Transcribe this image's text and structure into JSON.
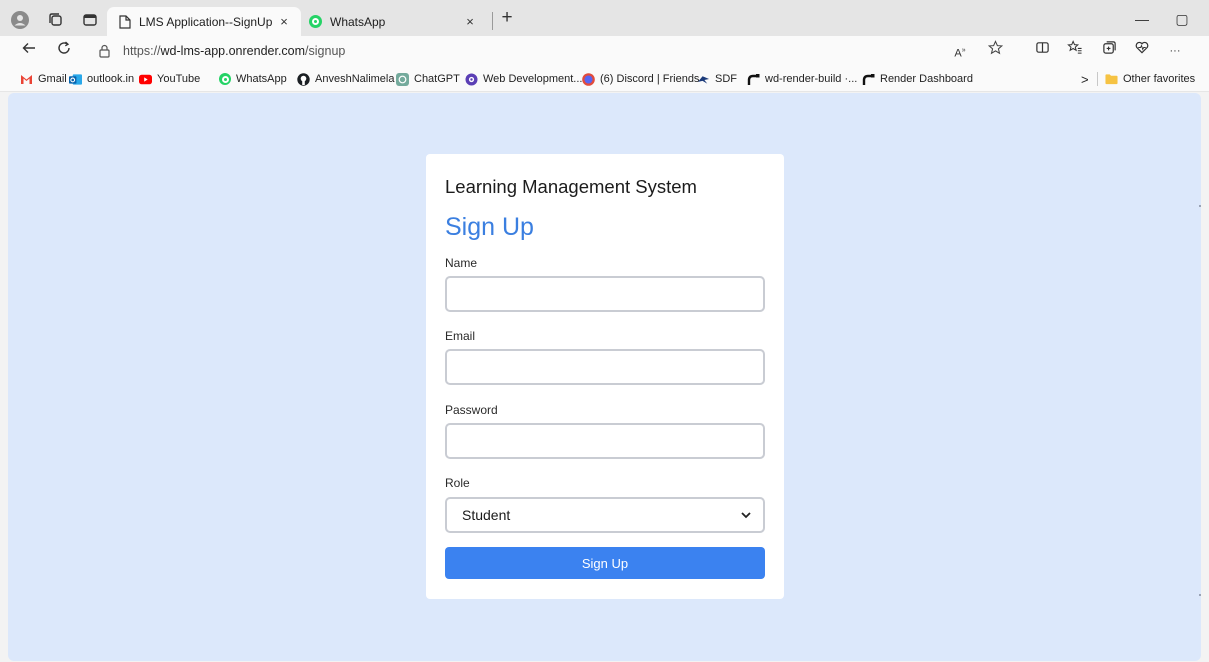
{
  "browser": {
    "tabs": [
      {
        "title": "LMS Application--SignUp Page",
        "close": "×",
        "active": true
      },
      {
        "title": "WhatsApp",
        "close": "×",
        "active": false
      }
    ],
    "new_tab": "+",
    "window_controls": {
      "minimize": "—",
      "restore": "▢"
    },
    "address_bar": {
      "scheme": "https://",
      "host": "wd-lms-app.onrender.com",
      "path": "/signup"
    },
    "toolbar_icons": [
      "read-aloud-icon",
      "favorite-star-icon",
      "split-screen-icon",
      "favorites-icon",
      "collections-icon",
      "health-icon",
      "more-icon"
    ],
    "more_label": "···",
    "favorites": [
      {
        "label": "Gmail",
        "icon": "gmail-icon"
      },
      {
        "label": "outlook.in",
        "icon": "outlook-icon"
      },
      {
        "label": "YouTube",
        "icon": "youtube-icon"
      },
      {
        "label": "WhatsApp",
        "icon": "whatsapp-icon"
      },
      {
        "label": "AnveshNalimela",
        "icon": "github-icon"
      },
      {
        "label": "ChatGPT",
        "icon": "chatgpt-icon"
      },
      {
        "label": "Web Development...",
        "icon": "web-dev-icon"
      },
      {
        "label": "(6) Discord | Friends",
        "icon": "discord-icon"
      },
      {
        "label": "SDF",
        "icon": "sdf-icon"
      },
      {
        "label": "wd-render-build ·...",
        "icon": "render-icon"
      },
      {
        "label": "Render Dashboard",
        "icon": "render-icon"
      }
    ],
    "favorites_overflow": ">",
    "other_favorites": "Other favorites"
  },
  "page": {
    "app_heading": "Learning Management System",
    "form_title": "Sign Up",
    "fields": {
      "name_label": "Name",
      "email_label": "Email",
      "password_label": "Password",
      "role_label": "Role",
      "role_value": "Student"
    },
    "submit_label": "Sign Up"
  },
  "colors": {
    "page_background": "#dce8fb",
    "accent": "#3b82f0",
    "title_blue": "#3b7fe0"
  }
}
